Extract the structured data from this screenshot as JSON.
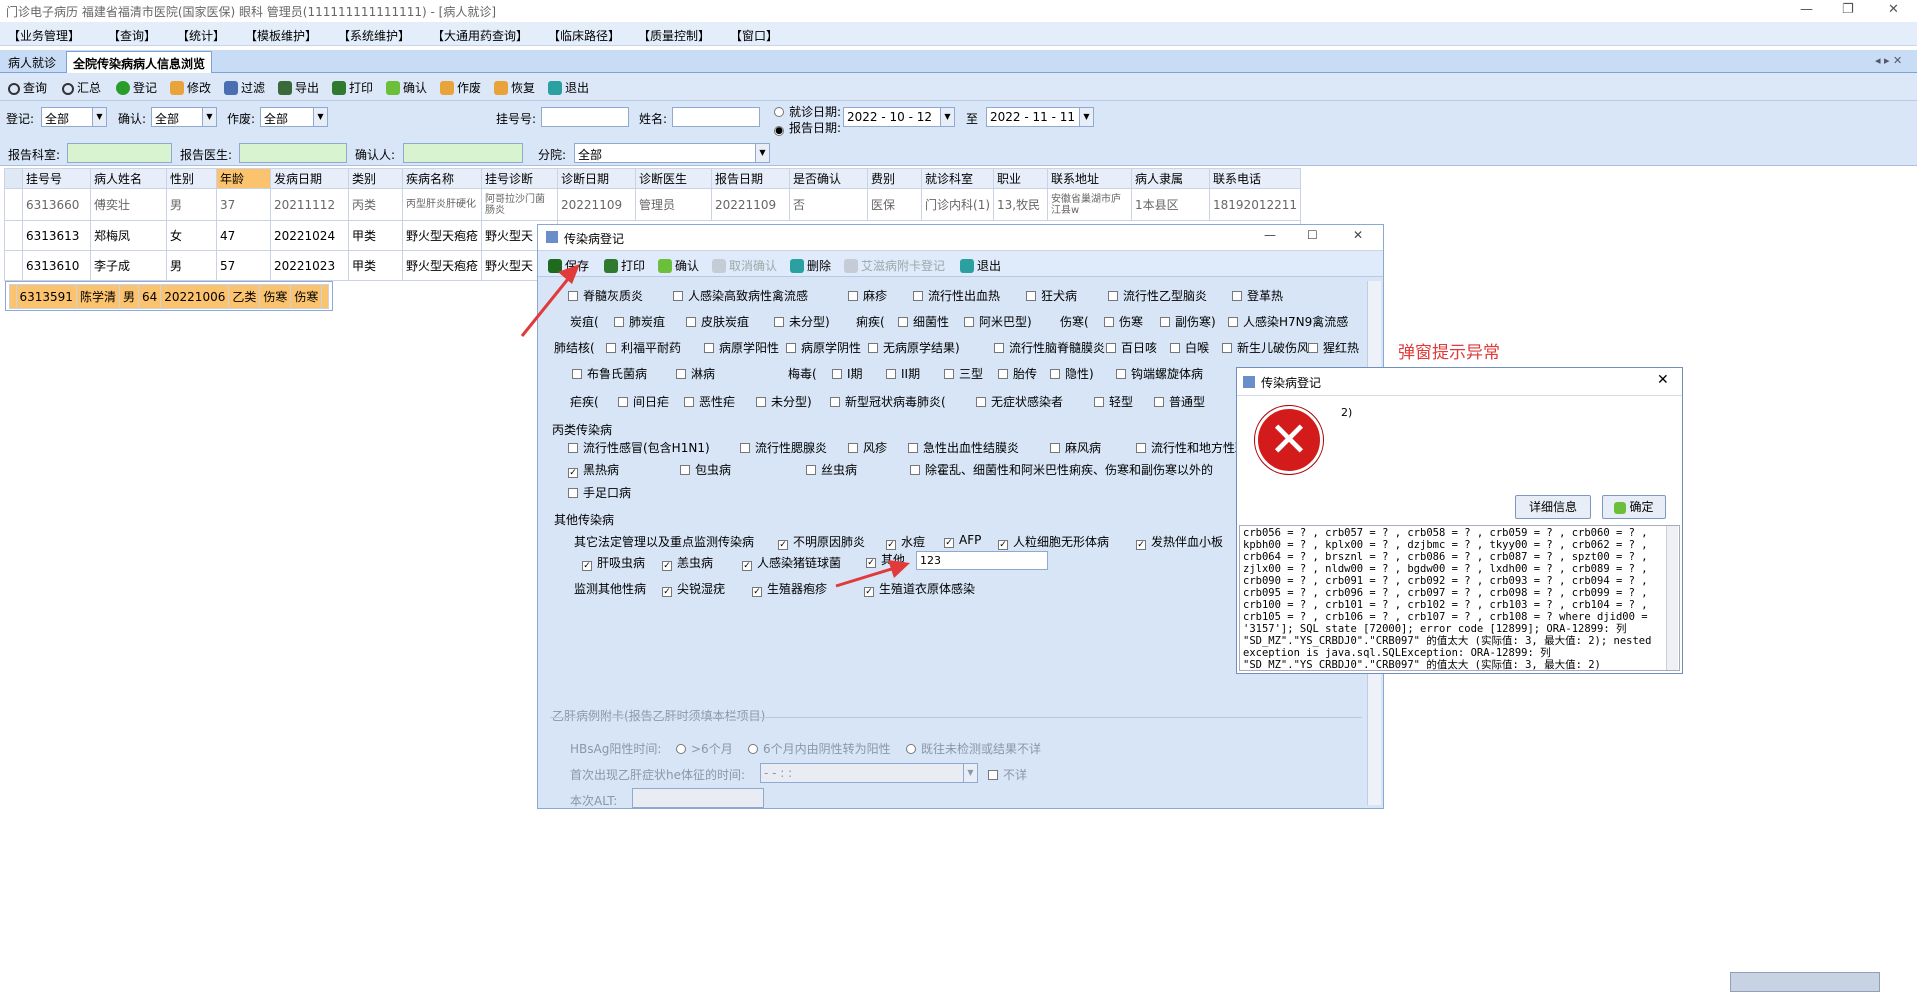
{
  "window": {
    "title": "门诊电子病历  福建省福清市医院(国家医保)  眼科  管理员(111111111111111) - [病人就诊]"
  },
  "menu": [
    "【业务管理】",
    "【查询】",
    "【统计】",
    "【模板维护】",
    "【系统维护】",
    "【大通用药查询】",
    "【临床路径】",
    "【质量控制】",
    "【窗口】"
  ],
  "tabs": [
    "病人就诊",
    "全院传染病病人信息浏览"
  ],
  "toolbar": [
    "查询",
    "汇总",
    "登记",
    "修改",
    "过滤",
    "导出",
    "打印",
    "确认",
    "作废",
    "恢复",
    "退出"
  ],
  "filter": {
    "reg_label": "登记:",
    "reg_value": "全部",
    "confirm_label": "确认:",
    "confirm_value": "全部",
    "void_label": "作废:",
    "void_value": "全部",
    "regno_label": "挂号号:",
    "name_label": "姓名:",
    "visit_date_label": "就诊日期:",
    "report_date_label": "报告日期:",
    "date_from": "2022 - 10 - 12",
    "to_label": "至",
    "date_to": "2022 - 11 - 11",
    "dept_label": "报告科室:",
    "doctor_label": "报告医生:",
    "confirmer_label": "确认人:",
    "branch_label": "分院:",
    "branch_value": "全部"
  },
  "table": {
    "headers": [
      "挂号号",
      "病人姓名",
      "性别",
      "年龄",
      "发病日期",
      "类别",
      "疾病名称",
      "挂号诊断",
      "诊断日期",
      "诊断医生",
      "报告日期",
      "是否确认",
      "费别",
      "就诊科室",
      "职业",
      "联系地址",
      "病人隶属",
      "联系电话"
    ],
    "rows": [
      [
        "6313660",
        "傅奕壮",
        "男",
        "37",
        "20211112",
        "丙类",
        "丙型肝炎肝硬化",
        "阿哥拉沙门菌肠炎",
        "20221109",
        "管理员",
        "20221109",
        "否",
        "医保",
        "门诊内科(1)",
        "13,牧民",
        "安徽省巢湖市庐江县w",
        "1本县区",
        "18192012211"
      ],
      [
        "6313613",
        "郑梅凤",
        "女",
        "47",
        "20221024",
        "甲类",
        "野火型天疱疮",
        "野火型天",
        "",
        "",
        "",
        "",
        "",
        "",
        "",
        "",
        "",
        ""
      ],
      [
        "6313610",
        "李子成",
        "男",
        "57",
        "20221023",
        "甲类",
        "野火型天疱疮",
        "野火型天",
        "",
        "",
        "",
        "",
        "",
        "",
        "",
        "",
        "",
        ""
      ],
      [
        "6313591",
        "陈学清",
        "男",
        "64",
        "20221006",
        "乙类",
        "伤寒",
        "伤寒",
        "",
        "",
        "",
        "",
        "",
        "",
        "",
        "",
        "",
        ""
      ]
    ]
  },
  "dialog1": {
    "title": "传染病登记",
    "toolbar": [
      "保存",
      "打印",
      "确认",
      "取消确认",
      "删除",
      "艾滋病附卡登记",
      "退出"
    ],
    "row1": [
      "脊髓灰质炎",
      "人感染高致病性禽流感",
      "麻疹",
      "流行性出血热",
      "狂犬病",
      "流行性乙型脑炎",
      "登革热"
    ],
    "row2_label": "炭疽(",
    "row2": [
      "肺炭疽",
      "皮肤炭疽",
      "未分型)"
    ],
    "row2b_label": "痢疾(",
    "row2b": [
      "细菌性",
      "阿米巴型)"
    ],
    "row2c_label": "伤寒(",
    "row2c": [
      "伤寒",
      "副伤寒)",
      "人感染H7N9禽流感"
    ],
    "row3_label": "肺结核(",
    "row3": [
      "利福平耐药",
      "病原学阳性",
      "病原学阴性",
      "无病原学结果)",
      "流行性脑脊髓膜炎",
      "百日咳",
      "白喉",
      "新生儿破伤风",
      "猩红热"
    ],
    "row4": [
      "布鲁氏菌病",
      "淋病"
    ],
    "row4_label": "梅毒(",
    "row4b": [
      "I期",
      "II期",
      "三型",
      "胎传",
      "隐性)",
      "钩端螺旋体病"
    ],
    "row5_label": "疟疾(",
    "row5": [
      "间日疟",
      "恶性疟",
      "未分型)",
      "新型冠状病毒肺炎(",
      "无症状感染者",
      "轻型",
      "普通型"
    ],
    "class_c": "丙类传染病",
    "c1": [
      "流行性感冒(包含H1N1)",
      "流行性腮腺炎",
      "风疹",
      "急性出血性结膜炎",
      "麻风病",
      "流行性和地方性斑"
    ],
    "c2": [
      "黑热病",
      "包虫病",
      "丝虫病",
      "除霍乱、细菌性和阿米巴性痢疾、伤寒和副伤寒以外的"
    ],
    "c3": [
      "手足口病"
    ],
    "other": "其他传染病",
    "o_label": "其它法定管理以及重点监测传染病",
    "o1": [
      "不明原因肺炎",
      "水痘",
      "AFP",
      "人粒细胞无形体病",
      "发热伴血小板"
    ],
    "o2": [
      "肝吸虫病",
      "恙虫病",
      "人感染猪链球菌",
      "其他"
    ],
    "other_value": "123",
    "monitor_label": "监测其他性病",
    "o3": [
      "尖锐湿疣",
      "生殖器疱疹",
      "生殖道衣原体感染"
    ],
    "hep_title": "乙肝病例附卡(报告乙肝时须填本栏项目)",
    "hbsag_label": "HBsAg阳性时间:",
    "hbsag_opts": [
      ">6个月",
      "6个月内由阴性转为阳性",
      "既往未检测或结果不详"
    ],
    "first_label": "首次出现乙肝症状he体征的时间:",
    "first_value": "-  -    :  :",
    "unknown": "不详",
    "alt_label": "本次ALT:"
  },
  "dialog2": {
    "title": "传染病登记",
    "message": "2)",
    "details_btn": "详细信息",
    "ok_btn": "确定",
    "details": "crb056 = ? , crb057 = ? , crb058 = ? , crb059 = ? , crb060 = ? ,\nkpbh00 = ? , kplx00 = ? , dzjbmc = ? , tkyy00 = ? , crb062 = ? ,\ncrb064 = ? , brsznl = ? , crb086 = ? , crb087 = ? , spzt00 = ? ,\nzjlx00 = ? , nldw00 = ? , bgdw00 = ? , lxdh00 = ? , crb089 = ? ,\ncrb090 = ? , crb091 = ? , crb092 = ? , crb093 = ? , crb094 = ? ,\ncrb095 = ? , crb096 = ? , crb097 = ? , crb098 = ? , crb099 = ? ,\ncrb100 = ? , crb101 = ? , crb102 = ? , crb103 = ? , crb104 = ? ,\ncrb105 = ? , crb106 = ? , crb107 = ? , crb108 = ? where djid00 =\n'3157']; SQL state [72000]; error code [12899]; ORA-12899: 列\n\"SD_MZ\".\"YS_CRBDJ0\".\"CRB097\" 的值太大 (实际值: 3, 最大值: 2); nested\nexception is java.sql.SQLException: ORA-12899: 列\n\"SD_MZ\".\"YS_CRBDJ0\".\"CRB097\" 的值太大 (实际值: 3, 最大值: 2)"
  },
  "annotation": "弹窗提示异常",
  "colors": {
    "accent": "#fbc36e",
    "annotation": "#e03a3a",
    "error": "#d31b1b"
  }
}
